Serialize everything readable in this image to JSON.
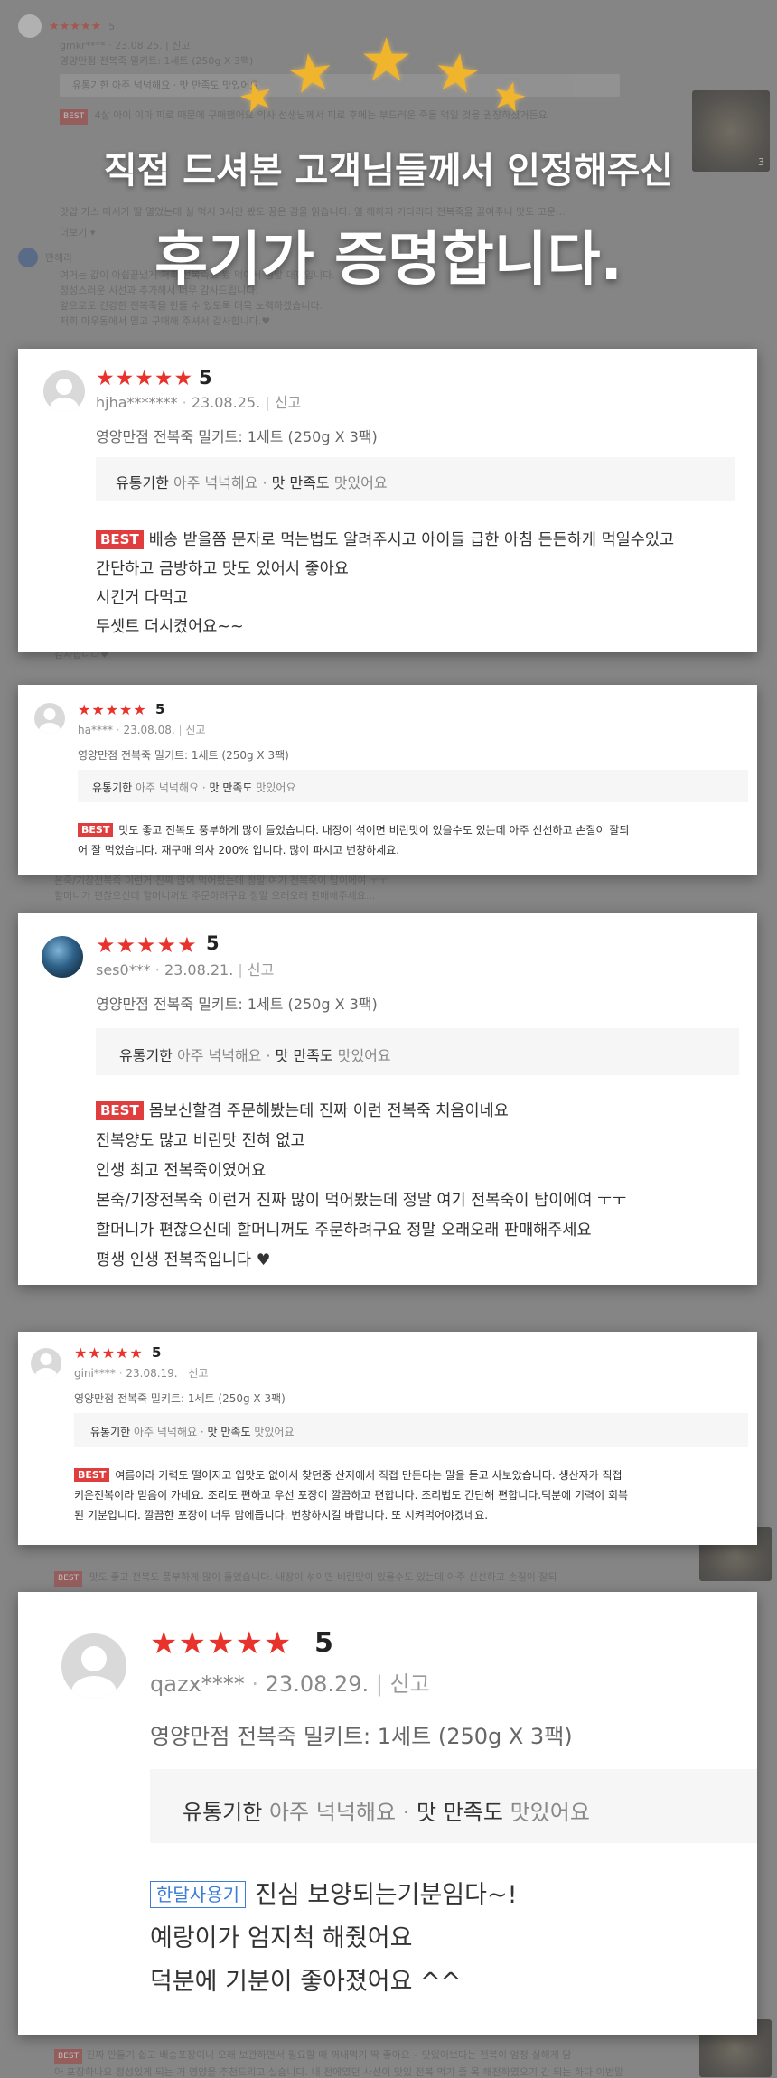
{
  "colors": {
    "star_red": "#e8322b",
    "best_red": "#e03e3e",
    "gold": "#f0b52c",
    "month_tag_blue": "#3b7dd8"
  },
  "header": {
    "decoration_icon": "gold-star-icon",
    "subtitle": "직접 드셔본 고객님들께서 인정해주신",
    "title": "후기가 증명합니다."
  },
  "background": {
    "review1": {
      "stars": "★★★★★",
      "score": "5",
      "meta": "gmkr**** · 23.08.25. | 신고",
      "product": "영양만점 전복죽 밀키트: 1세트 (250g X 3팩)",
      "rating": "유통기한 아주 넉넉해요 · 맛 만족도 맛있어요",
      "best": "BEST",
      "text": "4살 아이 이마 피로 때문에 구매했어요 의사 선생님께서 피로 후에는 부드러운 죽을 먹일 것을 권장하셨거든요",
      "thumb_count": "3"
    },
    "review2": {
      "text1": "맛압 가스 따서가 딸 열었는데 실 먹시 3시간 봤도 꽁은 감을 읽습니다. 열 해하지 기다리다 전복죽을 끓여주니 맛도 고운...",
      "more": "더보기 ▾",
      "user": "만해라",
      "text2": "여거는 값이 아쉽끝냈게 저희 선복죽도 봤 먹어서 정말 대형입니다.",
      "text3": "정성스러운 시선과 추가해서 너무 감사드립니다.",
      "text4": "앞으로도 건강한 전복죽을 만들 수 있도록 더욱 노력하겠습니다.",
      "text5": "저희 마우동에서 믿고 구매해 주셔서 감사합니다.♥"
    },
    "review3": {
      "text": "감사합니다♥"
    },
    "review4": {
      "text1": "본죽/기장전복죽 이런거 진짜 많이 먹어봤는데 정말 여기 전복죽이 탑이에여 ㅜㅜ",
      "text2": "할머니가 편찮으신데 할머니꺼도 주문하려구요 정말 오래오래 판매해주세요..."
    },
    "review5": {
      "best": "BEST",
      "text": "맛도 좋고 전복도 풍부하게 많이 들었습니다. 내장이 섞이면 비린맛이 있을수도 있는데 아주 신선하고 손질이 잘되"
    },
    "review6": {
      "best": "BEST",
      "text": "진짜 만들기 쉽고 배송포장이니 오래 보관하면서 필요할 때 꺼내먹기 딱 좋아요~ 맛있어보다는 전복이 엄청 실해게 담",
      "text2": "아 포장하나요 정성있게 되는 거 영양을 추천드리고 싶습니다. 내 전에였던 사선이 맛있 전복 먹기 줄 목 해전하였오기 간 되는 하다 이번말"
    }
  },
  "reviews": [
    {
      "stars": "★★★★★",
      "score": "5",
      "user": "hjha*******",
      "date": "23.08.25.",
      "report": "신고",
      "product": "영양만점 전복죽 밀키트: 1세트 (250g X 3팩)",
      "rating_label1": "유통기한",
      "rating_value1": "아주 넉넉해요",
      "rating_label2": "맛 만족도",
      "rating_value2": "맛있어요",
      "tag": "BEST",
      "lines": [
        "배송 받을쯤 문자로 먹는법도 알려주시고 아이들 급한 아침 든든하게 먹일수있고",
        "간단하고 금방하고 맛도 있어서 좋아요",
        "시킨거 다먹고",
        "두셋트 더시켰어요~~"
      ]
    },
    {
      "stars": "★★★★★",
      "score": "5",
      "user": "ha****",
      "date": "23.08.08.",
      "report": "신고",
      "product": "영양만점 전복죽 밀키트: 1세트 (250g X 3팩)",
      "rating_label1": "유통기한",
      "rating_value1": "아주 넉넉해요",
      "rating_label2": "맛 만족도",
      "rating_value2": "맛있어요",
      "tag": "BEST",
      "lines": [
        "맛도 좋고 전복도 풍부하게 많이 들었습니다. 내장이 섞이면 비린맛이 있을수도 있는데 아주 신선하고 손질이 잘되",
        "어 잘 먹었습니다. 재구매 의사 200% 입니다. 많이 파시고 번창하세요."
      ]
    },
    {
      "stars": "★★★★★",
      "score": "5",
      "user": "ses0***",
      "date": "23.08.21.",
      "report": "신고",
      "product": "영양만점 전복죽 밀키트: 1세트 (250g X 3팩)",
      "rating_label1": "유통기한",
      "rating_value1": "아주 넉넉해요",
      "rating_label2": "맛 만족도",
      "rating_value2": "맛있어요",
      "tag": "BEST",
      "lines": [
        "몸보신할겸 주문해봤는데 진짜 이런 전복죽 처음이네요",
        "전복양도 많고 비린맛 전혀 없고",
        "인생 최고 전복죽이였어요",
        "본죽/기장전복죽 이런거 진짜 많이 먹어봤는데 정말 여기 전복죽이 탑이에여 ㅜㅜ",
        "할머니가 편찮으신데 할머니꺼도 주문하려구요 정말 오래오래 판매해주세요",
        "평생 인생 전복죽입니다 ♥"
      ]
    },
    {
      "stars": "★★★★★",
      "score": "5",
      "user": "gini****",
      "date": "23.08.19.",
      "report": "신고",
      "product": "영양만점 전복죽 밀키트: 1세트 (250g X 3팩)",
      "rating_label1": "유통기한",
      "rating_value1": "아주 넉넉해요",
      "rating_label2": "맛 만족도",
      "rating_value2": "맛있어요",
      "tag": "BEST",
      "lines": [
        "여름이라 기력도 떨어지고 입맛도 없어서 찾던중 산지에서 직접 만든다는 말을 듣고 사보았습니다. 생산자가 직접",
        "키운전복이라 믿음이 가네요. 조리도 편하고 우선 포장이 깔끔하고 편합니다. 조리법도 간단해 편합니다.덕분에 기력이 회복",
        "된 기분입니다. 깔끔한 포장이 너무 맘에듭니다. 번창하시길 바랍니다. 또 시켜먹어야겠네요."
      ]
    },
    {
      "stars": "★★★★★",
      "score": "5",
      "user": "qazx****",
      "date": "23.08.29.",
      "report": "신고",
      "product": "영양만점 전복죽 밀키트: 1세트 (250g X 3팩)",
      "rating_label1": "유통기한",
      "rating_value1": "아주 넉넉해요",
      "rating_label2": "맛 만족도",
      "rating_value2": "맛있어요",
      "tag": "한달사용기",
      "lines": [
        "진심 보양되는기분임다~!",
        "예랑이가 엄지척 해줬어요",
        "덕분에 기분이 좋아졌어요 ^^"
      ]
    }
  ]
}
